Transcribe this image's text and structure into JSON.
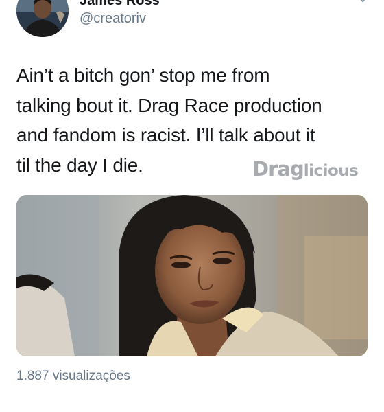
{
  "tweet": {
    "author_name": "James Ross",
    "author_handle": "@creatoriv",
    "text_lines": [
      "Ain’t a bitch gon’ stop me from",
      "talking bout it. Drag Race production",
      "and fandom is racist. I’ll talk about it",
      "til the day I die."
    ],
    "views": "1.887 visualizações"
  },
  "watermark": {
    "main": "Drag",
    "sub": "licious"
  },
  "icons": {
    "avatar": "profile-photo",
    "menu": "chevron-down-icon"
  },
  "colors": {
    "text": "#14171a",
    "secondary": "#657786",
    "watermark": "#9ea3a8"
  }
}
